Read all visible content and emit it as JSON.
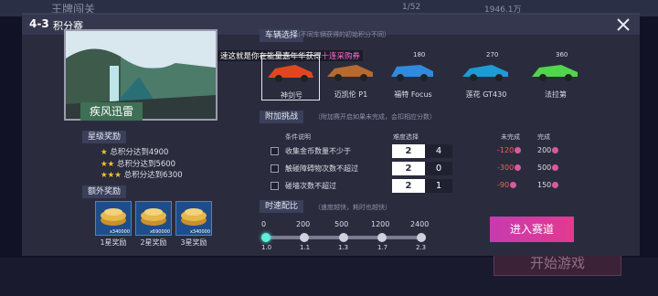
{
  "background": {
    "title": "王牌闯关",
    "counter": "1/52",
    "currency": "1946.1万",
    "start_button": "开始游戏"
  },
  "header": {
    "stage": "4-3",
    "title": "积分赛"
  },
  "track": {
    "name": "疾风迅雷"
  },
  "star_rewards": {
    "title": "星级奖励",
    "items": [
      {
        "stars": "★",
        "text": "总积分达到4900"
      },
      {
        "stars": "★★",
        "text": "总积分达到5600"
      },
      {
        "stars": "★★★",
        "text": "总积分达到6300"
      }
    ]
  },
  "extra_rewards": {
    "title": "额外奖励",
    "items": [
      {
        "amount": "x340000",
        "label": "1星奖励"
      },
      {
        "amount": "x690000",
        "label": "2星奖励"
      },
      {
        "amount": "x340000",
        "label": "3星奖励"
      }
    ]
  },
  "car_select": {
    "title": "车辆选择",
    "note": "（不同车辆获得的初始积分不同）",
    "banner_prefix": "速这就是你在能量嘉年华获得",
    "banner_highlight": "十连采购券",
    "cars": [
      {
        "name": "神剑号",
        "price": ""
      },
      {
        "name": "迈凯伦 P1",
        "price": ""
      },
      {
        "name": "福特 Focus",
        "price": "180"
      },
      {
        "name": "莲花 GT430",
        "price": "270"
      },
      {
        "name": "法拉第",
        "price": "360"
      }
    ]
  },
  "challenge": {
    "title": "附加挑战",
    "note": "（附加赛开启如果未完成，会扣相应分数）",
    "headers": {
      "condition": "条件说明",
      "difficulty": "难度选择",
      "fail": "未完成",
      "done": "完成"
    },
    "rows": [
      {
        "condition": "收集金币数量不少于",
        "diff_left": "2",
        "diff_right": "4",
        "fail": "-120",
        "done": "200"
      },
      {
        "condition": "触碰障碍物次数不超过",
        "diff_left": "2",
        "diff_right": "0",
        "fail": "-300",
        "done": "500"
      },
      {
        "condition": "碰墙次数不超过",
        "diff_left": "2",
        "diff_right": "1",
        "fail": "-90",
        "done": "150"
      }
    ]
  },
  "speed": {
    "title": "时速配比",
    "note": "（速度越快，耗时也越快）",
    "top_labels": [
      "0",
      "200",
      "500",
      "1200",
      "2400"
    ],
    "bottom_labels": [
      "1.0",
      "1.1",
      "1.3",
      "1.7",
      "2.3"
    ],
    "selected_index": 0
  },
  "enter_button": "进入赛道"
}
